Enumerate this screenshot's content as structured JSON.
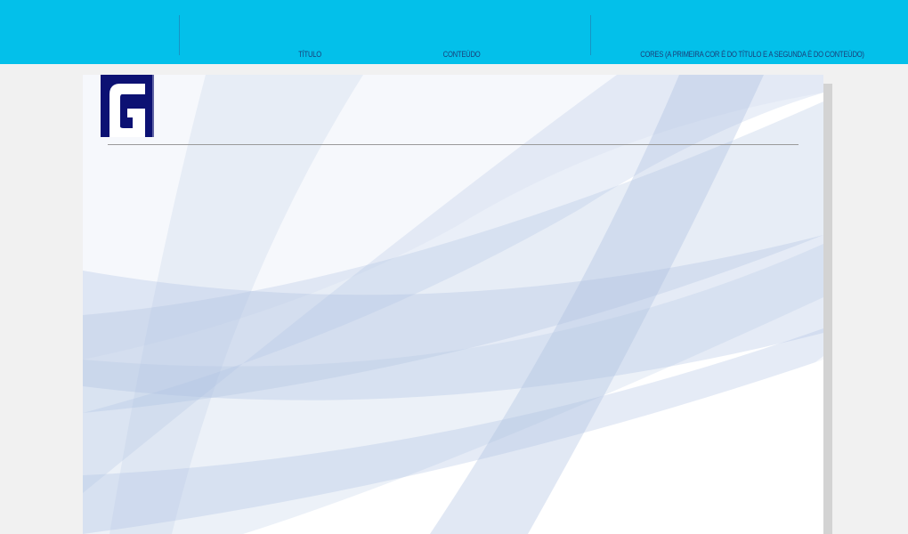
{
  "toolbar": {
    "background_color": "#03c0ea",
    "label_color": "#1a3f7a",
    "labels": {
      "title": "TÍTULO",
      "content": "CONTEÚDO",
      "colors": "CORES (A PRIMEIRA COR É DO TÍTULO E A SEGUNDA É DO CONTEÚDO)"
    }
  },
  "canvas": {
    "logo": {
      "icon": "g-logo-icon",
      "color": "#0c1173"
    },
    "background_color": "#ffffff",
    "wave_color": "#a9bde0"
  }
}
